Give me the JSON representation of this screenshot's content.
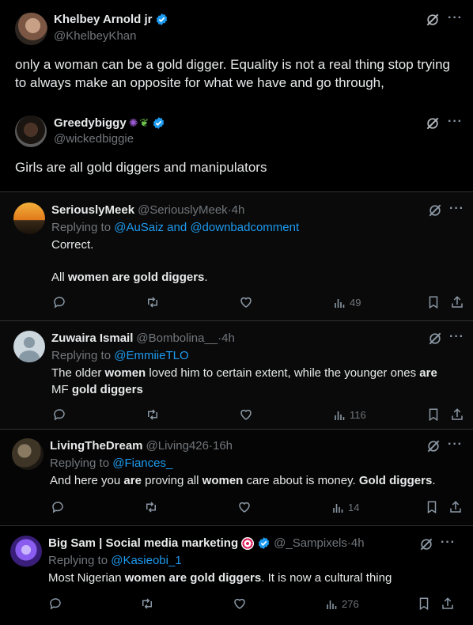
{
  "quoted_tweet": {
    "author_name": "Khelbey Arnold jr",
    "handle": "@KhelbeyKhan",
    "text": "only a woman can be a gold digger. Equality is not a real thing stop trying to always make an opposite for what we have and go through,",
    "inner": {
      "author_name": "Greedybiggy",
      "handle": "@wickedbiggie",
      "text": "Girls are all gold diggers and manipulators"
    }
  },
  "replies": [
    {
      "author_name": "SeriouslyMeek",
      "handle": "@SeriouslyMeek",
      "time": "4h",
      "replying_prefix": "Replying to ",
      "replying_to": "@AuSaiz and @downbadcomment",
      "line1": "Correct.",
      "line2_a": "All ",
      "line2_b": "women are gold diggers",
      "line2_c": ".",
      "views": "49"
    },
    {
      "author_name": "Zuwaira Ismail",
      "handle": "@Bombolina__",
      "time": "4h",
      "replying_prefix": "Replying to ",
      "replying_to": "@EmmiieTLO",
      "t_a": "The older ",
      "t_b": "women",
      "t_c": " loved him to certain extent, while the younger ones ",
      "t_d": "are",
      "t_e": "MF ",
      "t_f": "gold diggers",
      "views": "116"
    },
    {
      "author_name": "LivingTheDream",
      "handle": "@Living426",
      "time": "16h",
      "replying_prefix": "Replying to ",
      "replying_to": "@Fiances_",
      "t_a": "And here you ",
      "t_b": "are",
      "t_c": " proving all ",
      "t_d": "women",
      "t_e": " care about is money. ",
      "t_f": "Gold diggers",
      "t_g": ".",
      "views": "14"
    },
    {
      "author_name": "Big Sam | Social media marketing",
      "handle": "@_Sampixels",
      "time": "4h",
      "replying_prefix": "Replying to ",
      "replying_to": "@Kasieobi_1",
      "t_a": "Most Nigerian ",
      "t_b": "women are gold diggers",
      "t_c": ". It is now a cultural thing",
      "views": "276"
    }
  ],
  "separator": " · ",
  "more_label": "···",
  "colors": {
    "link": "#1d9bf0",
    "verified": "#1d9bf0",
    "muted": "#71767b",
    "background": "#000000"
  },
  "icons": [
    "verified-badge-icon",
    "grok-icon",
    "reply-icon",
    "retweet-icon",
    "like-icon",
    "views-icon",
    "bookmark-icon",
    "share-icon",
    "target-emoji-icon"
  ]
}
